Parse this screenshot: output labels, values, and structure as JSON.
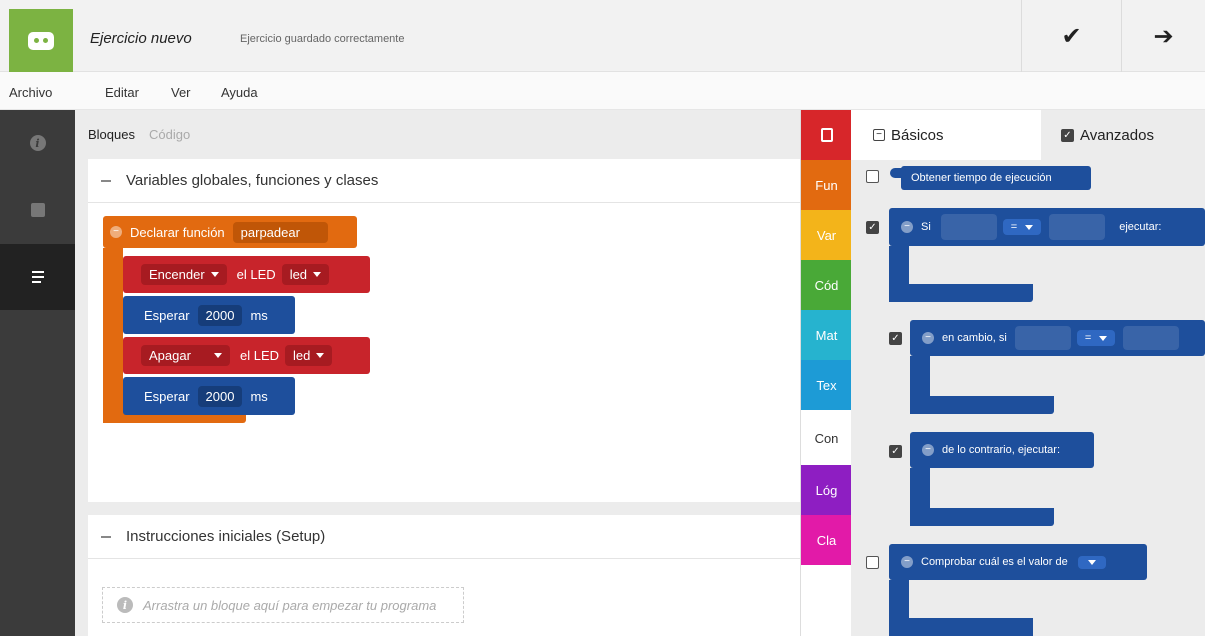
{
  "header": {
    "document_title": "Ejercicio nuevo",
    "save_status": "Ejercicio guardado correctamente",
    "check_icon": "✔",
    "next_icon": "➔"
  },
  "menu": {
    "items": [
      "Archivo",
      "Editar",
      "Ver",
      "Ayuda"
    ]
  },
  "workspace": {
    "tabs": [
      "Bloques",
      "Código"
    ],
    "globals_title": "Variables globales, funciones y clases",
    "setup_title": "Instrucciones iniciales (Setup)",
    "placeholder": "Arrastra un bloque aquí para empezar tu programa",
    "function_block": {
      "label": "Declarar función",
      "name": "parpadear",
      "color": "#e26a10"
    },
    "statements": [
      {
        "action": "Encender",
        "middle": "el LED",
        "target": "led",
        "color": "#c8242b"
      },
      {
        "action": "Esperar",
        "value": "2000",
        "unit": "ms",
        "color": "#1e4f9c"
      },
      {
        "action": "Apagar",
        "middle": "el LED",
        "target": "led",
        "color": "#c8242b"
      },
      {
        "action": "Esperar",
        "value": "2000",
        "unit": "ms",
        "color": "#1e4f9c"
      }
    ]
  },
  "categories": [
    {
      "label": "",
      "icon": "chip-icon",
      "color": "#d7262a"
    },
    {
      "label": "Fun",
      "color": "#e26a10"
    },
    {
      "label": "Var",
      "color": "#f3b41a"
    },
    {
      "label": "Cód",
      "color": "#49a937"
    },
    {
      "label": "Mat",
      "color": "#26b3cf"
    },
    {
      "label": "Tex",
      "color": "#1d9bd6"
    },
    {
      "label": "Con",
      "color": "#ffffff"
    },
    {
      "label": "Lóg",
      "color": "#8e1ec2"
    },
    {
      "label": "Cla",
      "color": "#e21aa8"
    }
  ],
  "toolbox": {
    "tab_basic": "Básicos",
    "tab_advanced": "Avanzados",
    "blocks": {
      "runtime": "Obtener tiempo de ejecución",
      "if_label": "Si",
      "if_op": "=",
      "if_do": "ejecutar:",
      "elseif_label": "en cambio, si",
      "elseif_op": "=",
      "else_label": "de lo contrario, ejecutar:",
      "switch_label": "Comprobar cuál es el valor de"
    }
  }
}
